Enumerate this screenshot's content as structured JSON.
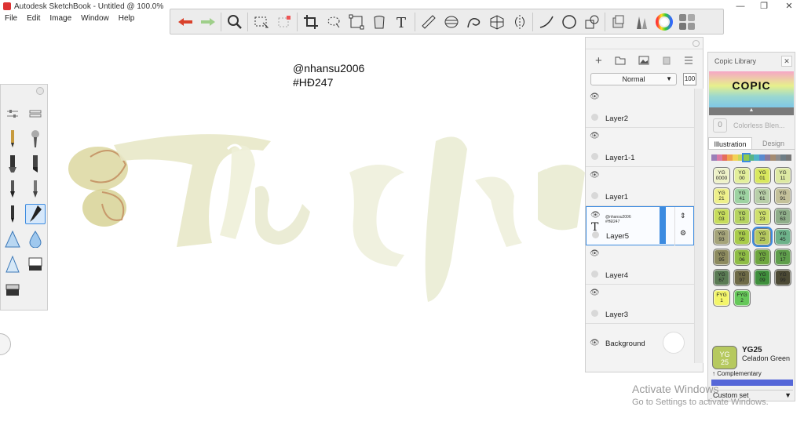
{
  "window": {
    "title": "Autodesk SketchBook - Untitled @ 100.0%",
    "minimize": "—",
    "maximize": "❐",
    "close": "✕"
  },
  "menu": [
    "File",
    "Edit",
    "Image",
    "Window",
    "Help"
  ],
  "toolbar_icons": [
    "undo-icon",
    "redo-icon",
    "zoom-icon",
    "select-icon",
    "transform-icon",
    "crop-icon",
    "lasso-icon",
    "distort-icon",
    "fill-icon",
    "text-icon",
    "ruler-icon",
    "ellipse-icon",
    "french-curve-icon",
    "perspective-icon",
    "symmetry-icon",
    "stroke-icon",
    "circle-icon",
    "shapes-icon",
    "copic-icon",
    "brush-set-icon",
    "color-wheel-icon",
    "palette-icon"
  ],
  "canvas": {
    "line1": "@nhansu2006",
    "line2": "#HĐ247"
  },
  "layer_panel": {
    "blend_mode": "Normal",
    "opacity": "100",
    "layers": [
      {
        "name": "Layer2",
        "thumb": ""
      },
      {
        "name": "Layer1-1",
        "thumb": ""
      },
      {
        "name": "Layer1",
        "thumb": ""
      },
      {
        "name": "Layer5",
        "thumb_line1": "@nhansu2006",
        "thumb_line2": "#HĐ247",
        "active": true
      },
      {
        "name": "Layer4",
        "thumb": ""
      },
      {
        "name": "Layer3",
        "thumb": ""
      }
    ],
    "background_label": "Background"
  },
  "copic": {
    "header": "Copic Library",
    "logo": "COPIC",
    "colorless_num": "0",
    "colorless_label": "Colorless Blen...",
    "tabs": [
      "Illustration",
      "Design"
    ],
    "swatches": [
      {
        "c": "YG",
        "n": "0000",
        "color": "#eef2c8"
      },
      {
        "c": "YG",
        "n": "00",
        "color": "#e3ef9b"
      },
      {
        "c": "YG",
        "n": "01",
        "color": "#d9e85e"
      },
      {
        "c": "YG",
        "n": "11",
        "color": "#dde9a2"
      },
      {
        "c": "YG",
        "n": "21",
        "color": "#eef08a"
      },
      {
        "c": "YG",
        "n": "41",
        "color": "#9ed3a2"
      },
      {
        "c": "YG",
        "n": "61",
        "color": "#b8cfa8"
      },
      {
        "c": "YG",
        "n": "91",
        "color": "#c4c19a"
      },
      {
        "c": "YG",
        "n": "03",
        "color": "#c7dd5c"
      },
      {
        "c": "YG",
        "n": "13",
        "color": "#b6d461"
      },
      {
        "c": "YG",
        "n": "23",
        "color": "#cfe06c"
      },
      {
        "c": "YG",
        "n": "63",
        "color": "#8fae8a"
      },
      {
        "c": "YG",
        "n": "93",
        "color": "#a5a47a"
      },
      {
        "c": "YG",
        "n": "05",
        "color": "#a9cc4a"
      },
      {
        "c": "YG",
        "n": "25",
        "color": "#b6c95f",
        "sel": true
      },
      {
        "c": "YG",
        "n": "45",
        "color": "#6db28a"
      },
      {
        "c": "YG",
        "n": "95",
        "color": "#8c8a5e"
      },
      {
        "c": "YG",
        "n": "06",
        "color": "#8fbd45"
      },
      {
        "c": "YG",
        "n": "07",
        "color": "#6ea63f"
      },
      {
        "c": "YG",
        "n": "17",
        "color": "#5f9e4c"
      },
      {
        "c": "YG",
        "n": "67",
        "color": "#5a7b54"
      },
      {
        "c": "YG",
        "n": "97",
        "color": "#6e6a46"
      },
      {
        "c": "YG",
        "n": "09",
        "color": "#3f8f3c"
      },
      {
        "c": "YG",
        "n": "99",
        "color": "#4c4a35"
      },
      {
        "c": "FYG",
        "n": "1",
        "color": "#f3f56a"
      },
      {
        "c": "FYG",
        "n": "2",
        "color": "#66c85a"
      }
    ],
    "selected": {
      "code": "YG25",
      "c": "YG",
      "n": "25",
      "name": "Celadon Green",
      "complementary": "Complementary"
    },
    "custom_set": "Custom set"
  },
  "watermark": {
    "title": "Activate Windows",
    "sub": "Go to Settings to activate Windows."
  }
}
